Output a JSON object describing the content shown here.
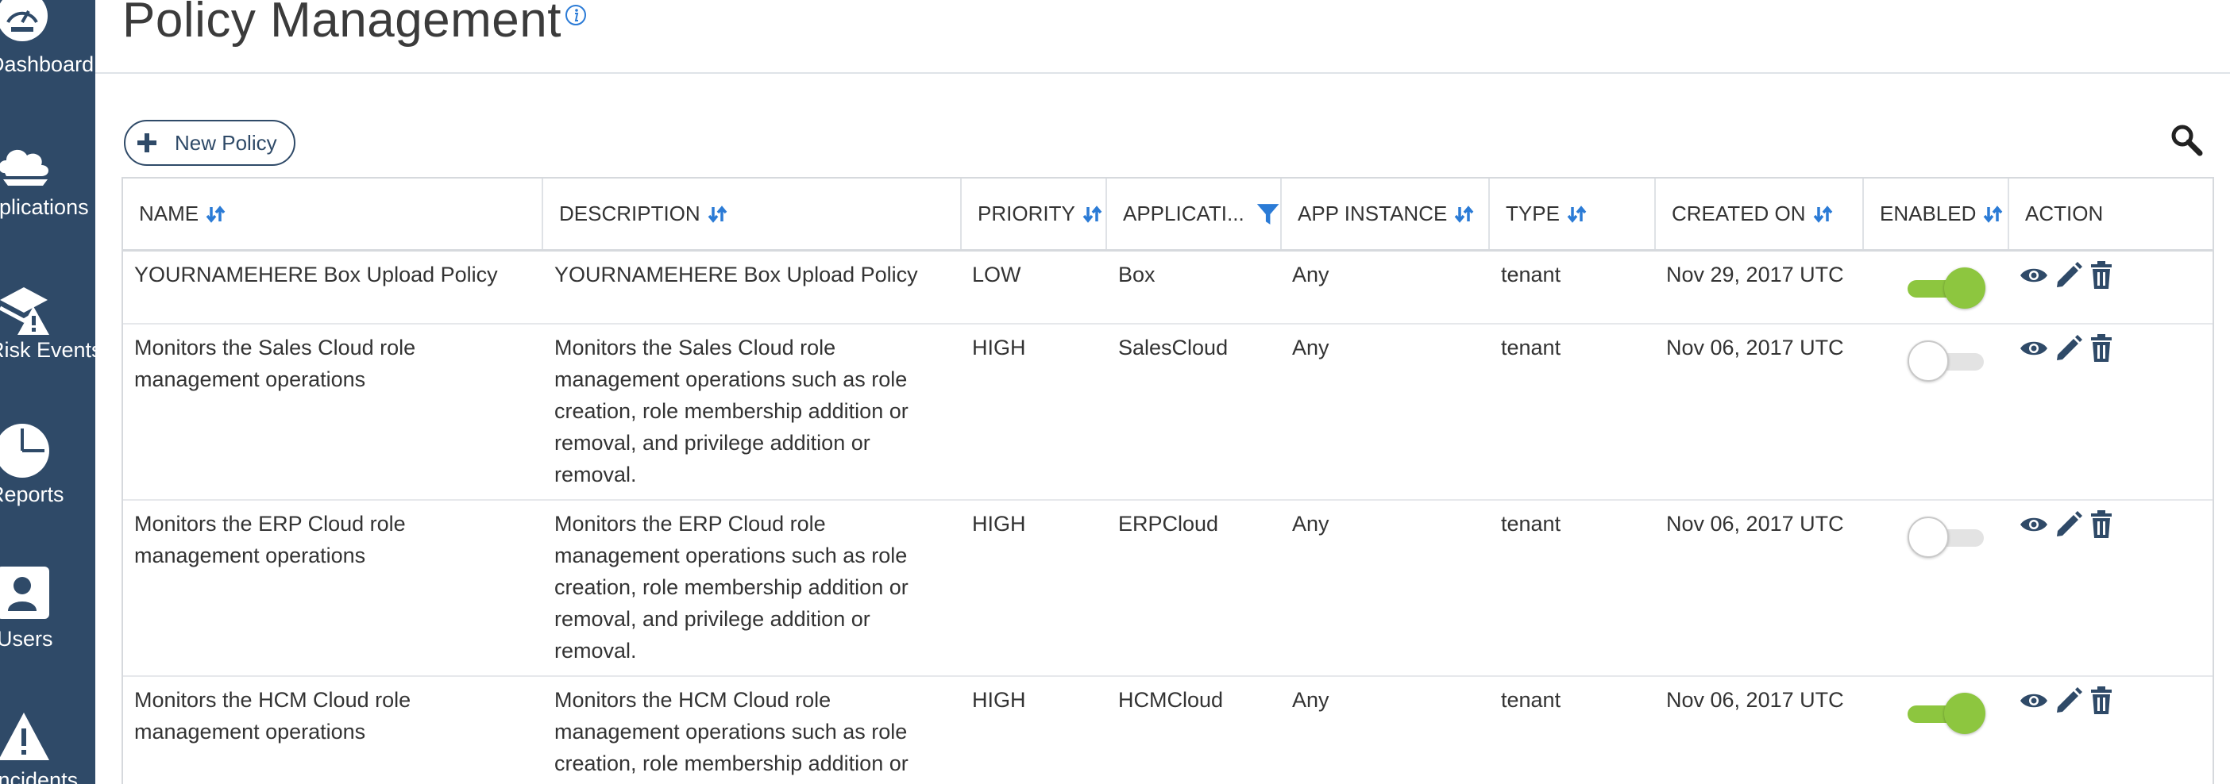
{
  "sidebar": {
    "items": [
      {
        "label": "Dashboard",
        "icon": "dashboard-gauge-icon"
      },
      {
        "label": "Applications",
        "icon": "cloud-apps-icon"
      },
      {
        "label": "Risk Events",
        "icon": "risk-events-icon"
      },
      {
        "label": "Reports",
        "icon": "pie-chart-icon"
      },
      {
        "label": "Users",
        "icon": "user-card-icon"
      },
      {
        "label": "Incidents",
        "icon": "warning-triangle-icon"
      }
    ],
    "background": "#2f4a68"
  },
  "header": {
    "title": "Policy Management",
    "info_icon": "info-icon"
  },
  "toolbar": {
    "new_policy_label": "New Policy",
    "search_icon": "search-icon"
  },
  "table": {
    "columns": [
      {
        "label": "NAME",
        "control": "sort"
      },
      {
        "label": "DESCRIPTION",
        "control": "sort"
      },
      {
        "label": "PRIORITY",
        "control": "sort"
      },
      {
        "label": "APPLICATI...",
        "control": "filter"
      },
      {
        "label": "APP INSTANCE",
        "control": "sort"
      },
      {
        "label": "TYPE",
        "control": "sort"
      },
      {
        "label": "CREATED ON",
        "control": "sort"
      },
      {
        "label": "ENABLED",
        "control": "sort"
      },
      {
        "label": "ACTION",
        "control": "none"
      }
    ],
    "rows": [
      {
        "name": [
          "YOURNAMEHERE Box Upload Policy"
        ],
        "description": [
          "YOURNAMEHERE Box Upload Policy"
        ],
        "priority": "LOW",
        "application": "Box",
        "app_instance": "Any",
        "type": "tenant",
        "created_on": "Nov 29, 2017 UTC",
        "enabled": true
      },
      {
        "name": [
          "Monitors the Sales Cloud role",
          "management operations"
        ],
        "description": [
          "Monitors the Sales Cloud role",
          "management operations such as role",
          "creation, role membership addition or",
          "removal, and privilege addition or",
          "removal."
        ],
        "priority": "HIGH",
        "application": "SalesCloud",
        "app_instance": "Any",
        "type": "tenant",
        "created_on": "Nov 06, 2017 UTC",
        "enabled": false
      },
      {
        "name": [
          "Monitors the ERP Cloud role",
          "management operations"
        ],
        "description": [
          "Monitors the ERP Cloud role",
          "management operations such as role",
          "creation, role membership addition or",
          "removal, and privilege addition or",
          "removal."
        ],
        "priority": "HIGH",
        "application": "ERPCloud",
        "app_instance": "Any",
        "type": "tenant",
        "created_on": "Nov 06, 2017 UTC",
        "enabled": false
      },
      {
        "name": [
          "Monitors the HCM Cloud role",
          "management operations"
        ],
        "description": [
          "Monitors the HCM Cloud role",
          "management operations such as role",
          "creation, role membership addition or"
        ],
        "priority": "HIGH",
        "application": "HCMCloud",
        "app_instance": "Any",
        "type": "tenant",
        "created_on": "Nov 06, 2017 UTC",
        "enabled": true
      }
    ],
    "action_icons": [
      "view-eye-icon",
      "edit-pencil-icon",
      "delete-trash-icon"
    ]
  },
  "colors": {
    "accent_blue": "#2b7bd6",
    "toggle_on": "#8dc63f",
    "toggle_off": "#e3e3e3",
    "icon_dark": "#2f4a68"
  }
}
